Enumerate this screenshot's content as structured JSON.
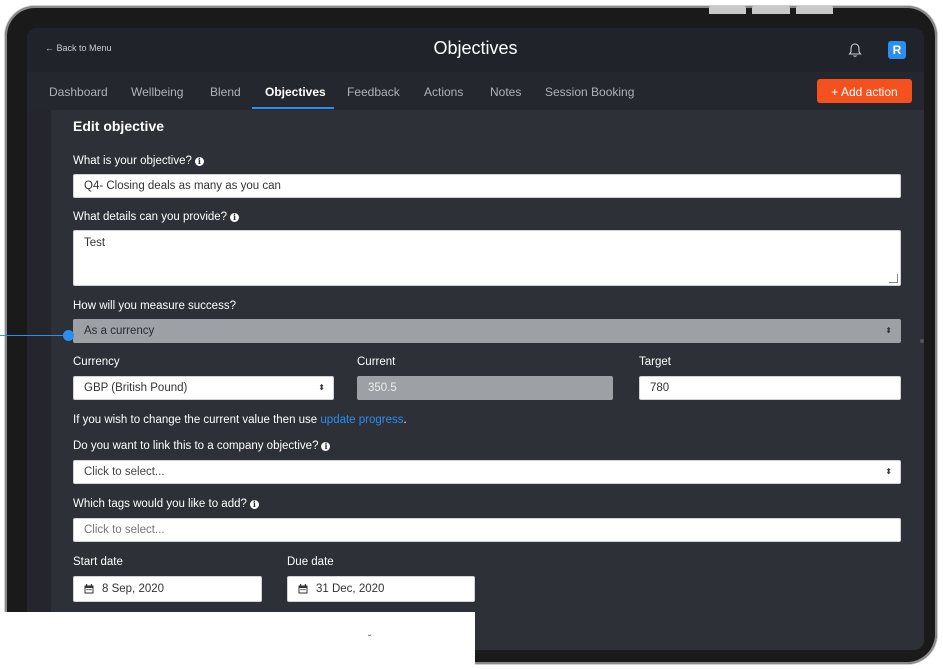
{
  "header": {
    "back_label": "← Back to Menu",
    "title": "Objectives",
    "avatar_initial": "R"
  },
  "tabs": [
    {
      "label": "Dashboard",
      "active": false
    },
    {
      "label": "Wellbeing",
      "active": false
    },
    {
      "label": "Blend",
      "active": false
    },
    {
      "label": "Objectives",
      "active": true
    },
    {
      "label": "Feedback",
      "active": false
    },
    {
      "label": "Actions",
      "active": false
    },
    {
      "label": "Notes",
      "active": false
    },
    {
      "label": "Session Booking",
      "active": false
    }
  ],
  "add_action_label": "+ Add action",
  "form": {
    "title": "Edit objective",
    "objective_label": "What is your objective?",
    "objective_value": "Q4- Closing deals as many as you can",
    "details_label": "What details can you provide?",
    "details_value": "Test",
    "measure_label": "How will you measure success?",
    "measure_value": "As a currency",
    "currency_label": "Currency",
    "currency_value": "GBP (British Pound)",
    "current_label": "Current",
    "current_value": "350.5",
    "target_label": "Target",
    "target_value": "780",
    "update_note_prefix": "If you wish to change the current value then use ",
    "update_note_link": "update progress",
    "update_note_suffix": ".",
    "company_label": "Do you want to link this to a company objective?",
    "company_placeholder": "Click to select...",
    "tags_label": "Which tags would you like to add?",
    "tags_placeholder": "Click to select...",
    "start_label": "Start date",
    "start_value": "8 Sep, 2020",
    "due_label": "Due date",
    "due_value": "31 Dec, 2020"
  },
  "select_arrow_glyph": "⬍",
  "overlay_mark": "˘",
  "colors": {
    "accent": "#2c8ef0",
    "add_action": "#f4511e",
    "background": "#2d3036",
    "topbar": "#20232a"
  },
  "icons": [
    "bell-icon",
    "info-icon",
    "calendar-icon",
    "select-arrow-icon"
  ]
}
